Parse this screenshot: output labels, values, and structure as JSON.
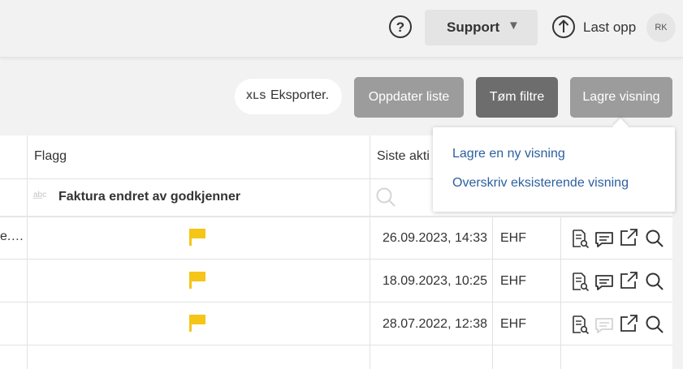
{
  "topbar": {
    "help_icon": "question-circle-icon",
    "support_label": "Support",
    "support_caret": "▼",
    "upload_label": "Last opp",
    "upload_icon": "upload-arrow-icon",
    "avatar_initials": "RK"
  },
  "toolbar": {
    "export_prefix": "XLS",
    "export_label": "Eksporter.",
    "update_label": "Oppdater liste",
    "clear_filters_label": "Tøm filtre",
    "save_view_label": "Lagre visning"
  },
  "save_view_menu": {
    "items": [
      "Lagre en ny visning",
      "Overskriv eksisterende visning"
    ]
  },
  "table": {
    "columns": {
      "flag": "Flagg",
      "last_activity": "Siste akti"
    },
    "filter": {
      "flag_filter_text": "Faktura endret av godkjenner",
      "text_filter_icon": "abc-icon"
    },
    "rows": [
      {
        "truncated_cell": "e.…",
        "flag_color": "#f5c518",
        "last_activity": "26.09.2023, 14:33",
        "format": "EHF",
        "comment_active": true
      },
      {
        "truncated_cell": "",
        "flag_color": "#f5c518",
        "last_activity": "18.09.2023, 10:25",
        "format": "EHF",
        "comment_active": true
      },
      {
        "truncated_cell": "",
        "flag_color": "#f5c518",
        "last_activity": "28.07.2022, 12:38",
        "format": "EHF",
        "comment_active": false
      }
    ],
    "row_action_icons": [
      "document-search-icon",
      "comment-icon",
      "external-link-icon",
      "search-icon"
    ]
  },
  "colors": {
    "accent_link": "#2c5f9e",
    "flag_yellow": "#f5c518",
    "button_gray": "#9c9c9c",
    "button_dark": "#6d6d6d"
  }
}
